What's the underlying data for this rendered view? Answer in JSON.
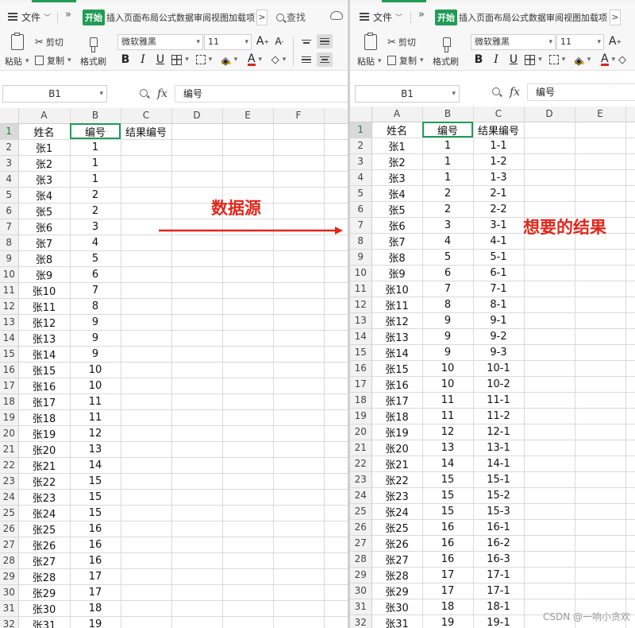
{
  "left": {
    "menu": {
      "file": "文件",
      "tabs_active": "开始",
      "tabs_rest": "插入页面布局公式数据审阅视图加载项安全",
      "more": ">",
      "search": "查找"
    },
    "ribbon": {
      "paste": "粘贴",
      "cut": "剪切",
      "copy": "复制",
      "format_painter": "格式刷",
      "font_name": "微软雅黑",
      "font_size": "11"
    },
    "formula": {
      "cell": "B1",
      "fx": "fx",
      "content": "编号"
    },
    "columns": [
      "A",
      "B",
      "C",
      "D",
      "E",
      "F"
    ],
    "rows": [
      [
        "1",
        "姓名",
        "编号",
        "结果编号"
      ],
      [
        "2",
        "张1",
        "1",
        ""
      ],
      [
        "3",
        "张2",
        "1",
        ""
      ],
      [
        "4",
        "张3",
        "1",
        ""
      ],
      [
        "5",
        "张4",
        "2",
        ""
      ],
      [
        "6",
        "张5",
        "2",
        ""
      ],
      [
        "7",
        "张6",
        "3",
        ""
      ],
      [
        "8",
        "张7",
        "4",
        ""
      ],
      [
        "9",
        "张8",
        "5",
        ""
      ],
      [
        "10",
        "张9",
        "6",
        ""
      ],
      [
        "11",
        "张10",
        "7",
        ""
      ],
      [
        "12",
        "张11",
        "8",
        ""
      ],
      [
        "13",
        "张12",
        "9",
        ""
      ],
      [
        "14",
        "张13",
        "9",
        ""
      ],
      [
        "15",
        "张14",
        "9",
        ""
      ],
      [
        "16",
        "张15",
        "10",
        ""
      ],
      [
        "17",
        "张16",
        "10",
        ""
      ],
      [
        "18",
        "张17",
        "11",
        ""
      ],
      [
        "19",
        "张18",
        "11",
        ""
      ],
      [
        "20",
        "张19",
        "12",
        ""
      ],
      [
        "21",
        "张20",
        "13",
        ""
      ],
      [
        "22",
        "张21",
        "14",
        ""
      ],
      [
        "23",
        "张22",
        "15",
        ""
      ],
      [
        "24",
        "张23",
        "15",
        ""
      ],
      [
        "25",
        "张24",
        "15",
        ""
      ],
      [
        "26",
        "张25",
        "16",
        ""
      ],
      [
        "27",
        "张26",
        "16",
        ""
      ],
      [
        "28",
        "张27",
        "16",
        ""
      ],
      [
        "29",
        "张28",
        "17",
        ""
      ],
      [
        "30",
        "张29",
        "17",
        ""
      ],
      [
        "31",
        "张30",
        "18",
        ""
      ],
      [
        "32",
        "张31",
        "19",
        ""
      ]
    ]
  },
  "right": {
    "menu": {
      "file": "文件",
      "tabs_active": "开始",
      "tabs_rest": "插入页面布局公式数据审阅视图加载项安全",
      "more": ">"
    },
    "ribbon": {
      "paste": "粘贴",
      "cut": "剪切",
      "copy": "复制",
      "format_painter": "格式刷",
      "font_name": "微软雅黑",
      "font_size": "11"
    },
    "formula": {
      "cell": "B1",
      "fx": "fx",
      "content": "编号"
    },
    "columns": [
      "A",
      "B",
      "C",
      "D",
      "E"
    ],
    "rows": [
      [
        "1",
        "姓名",
        "编号",
        "结果编号"
      ],
      [
        "2",
        "张1",
        "1",
        "1-1"
      ],
      [
        "3",
        "张2",
        "1",
        "1-2"
      ],
      [
        "4",
        "张3",
        "1",
        "1-3"
      ],
      [
        "5",
        "张4",
        "2",
        "2-1"
      ],
      [
        "6",
        "张5",
        "2",
        "2-2"
      ],
      [
        "7",
        "张6",
        "3",
        "3-1"
      ],
      [
        "8",
        "张7",
        "4",
        "4-1"
      ],
      [
        "9",
        "张8",
        "5",
        "5-1"
      ],
      [
        "10",
        "张9",
        "6",
        "6-1"
      ],
      [
        "11",
        "张10",
        "7",
        "7-1"
      ],
      [
        "12",
        "张11",
        "8",
        "8-1"
      ],
      [
        "13",
        "张12",
        "9",
        "9-1"
      ],
      [
        "14",
        "张13",
        "9",
        "9-2"
      ],
      [
        "15",
        "张14",
        "9",
        "9-3"
      ],
      [
        "16",
        "张15",
        "10",
        "10-1"
      ],
      [
        "17",
        "张16",
        "10",
        "10-2"
      ],
      [
        "18",
        "张17",
        "11",
        "11-1"
      ],
      [
        "19",
        "张18",
        "11",
        "11-2"
      ],
      [
        "20",
        "张19",
        "12",
        "12-1"
      ],
      [
        "21",
        "张20",
        "13",
        "13-1"
      ],
      [
        "22",
        "张21",
        "14",
        "14-1"
      ],
      [
        "23",
        "张22",
        "15",
        "15-1"
      ],
      [
        "24",
        "张23",
        "15",
        "15-2"
      ],
      [
        "25",
        "张24",
        "15",
        "15-3"
      ],
      [
        "26",
        "张25",
        "16",
        "16-1"
      ],
      [
        "27",
        "张26",
        "16",
        "16-2"
      ],
      [
        "28",
        "张27",
        "16",
        "16-3"
      ],
      [
        "29",
        "张28",
        "17",
        "17-1"
      ],
      [
        "30",
        "张29",
        "17",
        "17-1"
      ],
      [
        "31",
        "张30",
        "18",
        "18-1"
      ],
      [
        "32",
        "张31",
        "19",
        "19-1"
      ]
    ]
  },
  "annotations": {
    "source_label": "数据源",
    "result_label": "想要的结果",
    "accent_color": "#e4261a"
  },
  "watermark": "CSDN @一响小贪欢",
  "colors": {
    "accent_green": "#1f9d55",
    "selection_gray": "#d9d9d9"
  }
}
